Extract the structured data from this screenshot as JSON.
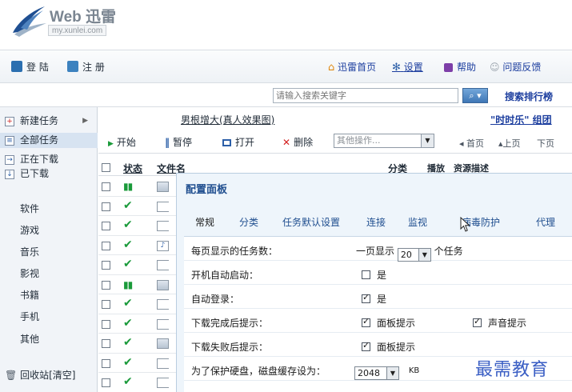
{
  "logo": {
    "title": "Web 迅雷",
    "url": "my.xunlei.com"
  },
  "toolbar": {
    "login": "登 陆",
    "register": "注 册",
    "home": "迅雷首页",
    "settings": "设置",
    "help": "帮助",
    "feedback": "问题反馈"
  },
  "search": {
    "placeholder": "请输入搜索关键字",
    "rank_label": "搜索排行榜"
  },
  "sidebar": {
    "tasks": [
      {
        "label": "新建任务"
      },
      {
        "label": "全部任务"
      },
      {
        "label": "正在下载"
      },
      {
        "label": "已下载"
      }
    ],
    "categories": [
      "软件",
      "游戏",
      "音乐",
      "影视",
      "书籍",
      "手机",
      "其他"
    ],
    "trash": "回收站[清空]"
  },
  "ads": {
    "left": "男根增大(真人效果图)",
    "right": "\"时时乐\" 组团"
  },
  "actions": {
    "start": "开始",
    "pause": "暂停",
    "open": "打开",
    "delete": "删除",
    "other_ops": "其他操作...",
    "first_page": "首页",
    "prev_page": "上页",
    "next_page": "下页"
  },
  "columns": {
    "status": "状态",
    "filename": "文件名",
    "category": "分类",
    "play": "播放",
    "resource": "资源描述"
  },
  "rows": [
    {
      "status": "pause",
      "icon": "doc-icon"
    },
    {
      "status": "done",
      "icon": "file-icon"
    },
    {
      "status": "done",
      "icon": "file-icon"
    },
    {
      "status": "done",
      "icon": "music-icon"
    },
    {
      "status": "done",
      "icon": "file-icon"
    },
    {
      "status": "pause",
      "icon": "doc-icon"
    },
    {
      "status": "done",
      "icon": "file-icon"
    },
    {
      "status": "done",
      "icon": "file-icon"
    },
    {
      "status": "done",
      "icon": "doc-icon"
    },
    {
      "status": "done",
      "icon": "file-icon"
    },
    {
      "status": "done",
      "icon": "file-icon"
    }
  ],
  "dialog": {
    "title": "配置面板",
    "tabs": [
      "常规",
      "分类",
      "任务默认设置",
      "连接",
      "监视",
      "病毒防护",
      "代理"
    ],
    "active_tab": "常规",
    "settings": {
      "max_tasks_label": "每页显示的任务数：",
      "max_tasks_prefix": "一页显示",
      "max_tasks_value": "20",
      "max_tasks_suffix": "个任务",
      "autostart_label": "开机自动启动：",
      "autostart_option": "是",
      "autostart_checked": false,
      "autologin_label": "自动登录：",
      "autologin_option": "是",
      "autologin_checked": true,
      "done_prompt_label": "下载完成后提示：",
      "done_panel_option": "面板提示",
      "done_panel_checked": true,
      "done_sound_option": "声音提示",
      "done_sound_checked": true,
      "fail_prompt_label": "下载失败后提示：",
      "fail_panel_option": "面板提示",
      "fail_panel_checked": true,
      "cache_label": "为了保护硬盘，磁盘缓存设为：",
      "cache_value": "2048",
      "cache_unit": "KB"
    }
  },
  "watermark": "最需教育",
  "colors": {
    "link": "#1b3d9e",
    "accent": "#2c5fa8",
    "ok_green": "#1a9a3a",
    "delete_red": "#d31d1d",
    "dialog_bg": "#eef5fb",
    "watermark": "#3a5ec4"
  }
}
